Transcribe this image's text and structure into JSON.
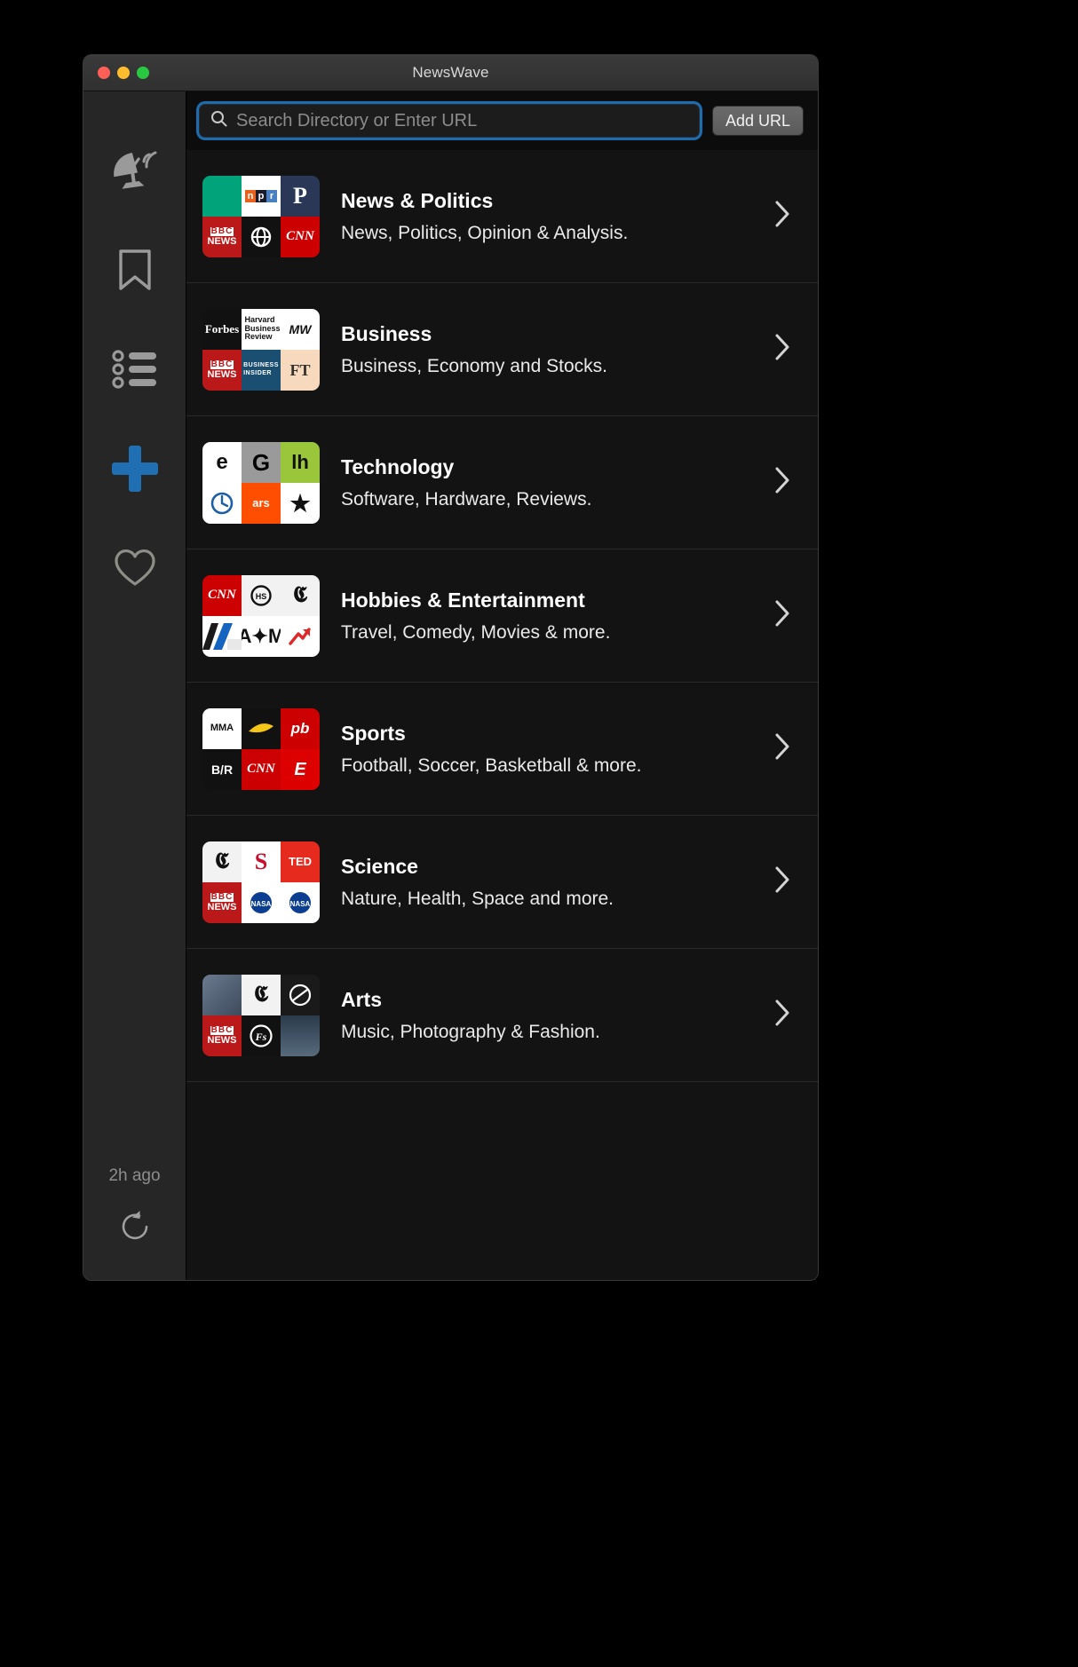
{
  "window": {
    "title": "NewsWave",
    "traffic_lights": [
      "close",
      "minimize",
      "zoom"
    ]
  },
  "sidebar": {
    "items": [
      {
        "name": "satellite-dish-icon",
        "label": "Discover"
      },
      {
        "name": "bookmark-icon",
        "label": "Bookmarks"
      },
      {
        "name": "list-icon",
        "label": "Reading List"
      },
      {
        "name": "plus-icon",
        "label": "Add Feed",
        "color": "#1f6fb2"
      },
      {
        "name": "heart-icon",
        "label": "Favorites"
      }
    ],
    "last_refresh": "2h ago",
    "refresh_label": "Refresh"
  },
  "toolbar": {
    "search_placeholder": "Search Directory or Enter URL",
    "search_value": "",
    "add_url_label": "Add URL",
    "focus_ring_color": "#1b6cb0"
  },
  "directory": {
    "rows": [
      {
        "title": "News & Politics",
        "subtitle": "News, Politics, Opinion & Analysis.",
        "thumbnail_logos": [
          "Teal",
          "npr",
          "PBS",
          "BBC NEWS",
          "CBC",
          "CNN"
        ]
      },
      {
        "title": "Business",
        "subtitle": "Business, Economy and Stocks.",
        "thumbnail_logos": [
          "Forbes",
          "Harvard Business Review",
          "MW",
          "BBC NEWS",
          "BUSINESS INSIDER",
          "FT"
        ]
      },
      {
        "title": "Technology",
        "subtitle": "Software, Hardware, Reviews.",
        "thumbnail_logos": [
          "Engadget",
          "Gizmodo",
          "Lifehacker",
          "The Verge",
          "ars",
          "Star"
        ]
      },
      {
        "title": "Hobbies & Entertainment",
        "subtitle": "Travel, Comedy, Movies & more.",
        "thumbnail_logos": [
          "CNN",
          "HS",
          "The New York Times",
          "Blue",
          "Atlas",
          "Flipboard"
        ]
      },
      {
        "title": "Sports",
        "subtitle": "Football, Soccer, Basketball & more.",
        "thumbnail_logos": [
          "MMA",
          "Black",
          "pb",
          "B/R",
          "CNN",
          "ESPN"
        ]
      },
      {
        "title": "Science",
        "subtitle": "Nature, Health, Space and more.",
        "thumbnail_logos": [
          "The New York Times",
          "S",
          "TED",
          "BBC NEWS",
          "NASA",
          "NASA"
        ]
      },
      {
        "title": "Arts",
        "subtitle": "Music, Photography & Fashion.",
        "thumbnail_logos": [
          "Photo",
          "The New York Times",
          "Dark",
          "BBC NEWS",
          "Fs",
          "City"
        ]
      }
    ],
    "chevron_icon": "chevron-right-icon"
  }
}
